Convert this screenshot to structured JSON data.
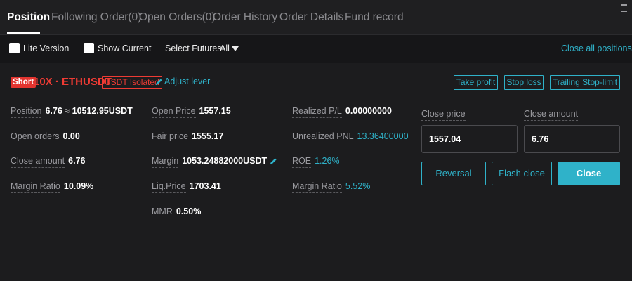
{
  "tabs": [
    {
      "label": "Position",
      "active": true
    },
    {
      "label": "Following Order(0)"
    },
    {
      "label": "Open Orders(0)"
    },
    {
      "label": "Order History"
    },
    {
      "label": "Order Details"
    },
    {
      "label": "Fund record"
    }
  ],
  "filters": {
    "lite_version": "Lite Version",
    "show_current": "Show Current",
    "select_futures_label": "Select Futures:",
    "select_futures_value": "All",
    "close_all": "Close all positions"
  },
  "position": {
    "side": "Short",
    "title": "10X · ETHUSDT",
    "margin_mode": "USDT Isolated",
    "adjust_lever": "Adjust lever",
    "actions": {
      "take_profit": "Take profit",
      "stop_loss": "Stop loss",
      "trailing": "Trailing Stop-limit"
    },
    "fields": {
      "position": {
        "label": "Position",
        "value": "6.76 ≈ 10512.95USDT"
      },
      "open_orders": {
        "label": "Open orders",
        "value": "0.00"
      },
      "close_amount": {
        "label": "Close amount",
        "value": "6.76"
      },
      "margin_ratio": {
        "label": "Margin Ratio",
        "value": "10.09%"
      },
      "open_price": {
        "label": "Open Price",
        "value": "1557.15"
      },
      "fair_price": {
        "label": "Fair price",
        "value": "1555.17"
      },
      "margin": {
        "label": "Margin",
        "value": "1053.24882000USDT"
      },
      "liq_price": {
        "label": "Liq.Price",
        "value": "1703.41"
      },
      "mmr": {
        "label": "MMR",
        "value": "0.50%"
      },
      "realized_pl": {
        "label": "Realized P/L",
        "value": "0.00000000"
      },
      "unrealized_pnl": {
        "label": "Unrealized PNL",
        "value": "13.36400000"
      },
      "roe": {
        "label": "ROE",
        "value": "1.26%"
      },
      "margin_ratio_2": {
        "label": "Margin Ratio",
        "value": "5.52%"
      }
    }
  },
  "close_panel": {
    "close_price_label": "Close price",
    "close_price_value": "1557.04",
    "close_amount_label": "Close amount",
    "close_amount_value": "6.76",
    "reversal": "Reversal",
    "flash_close": "Flash close",
    "close": "Close"
  },
  "colors": {
    "accent": "#2fb2c9",
    "short": "#e2342f",
    "background": "#1c1c1e"
  }
}
